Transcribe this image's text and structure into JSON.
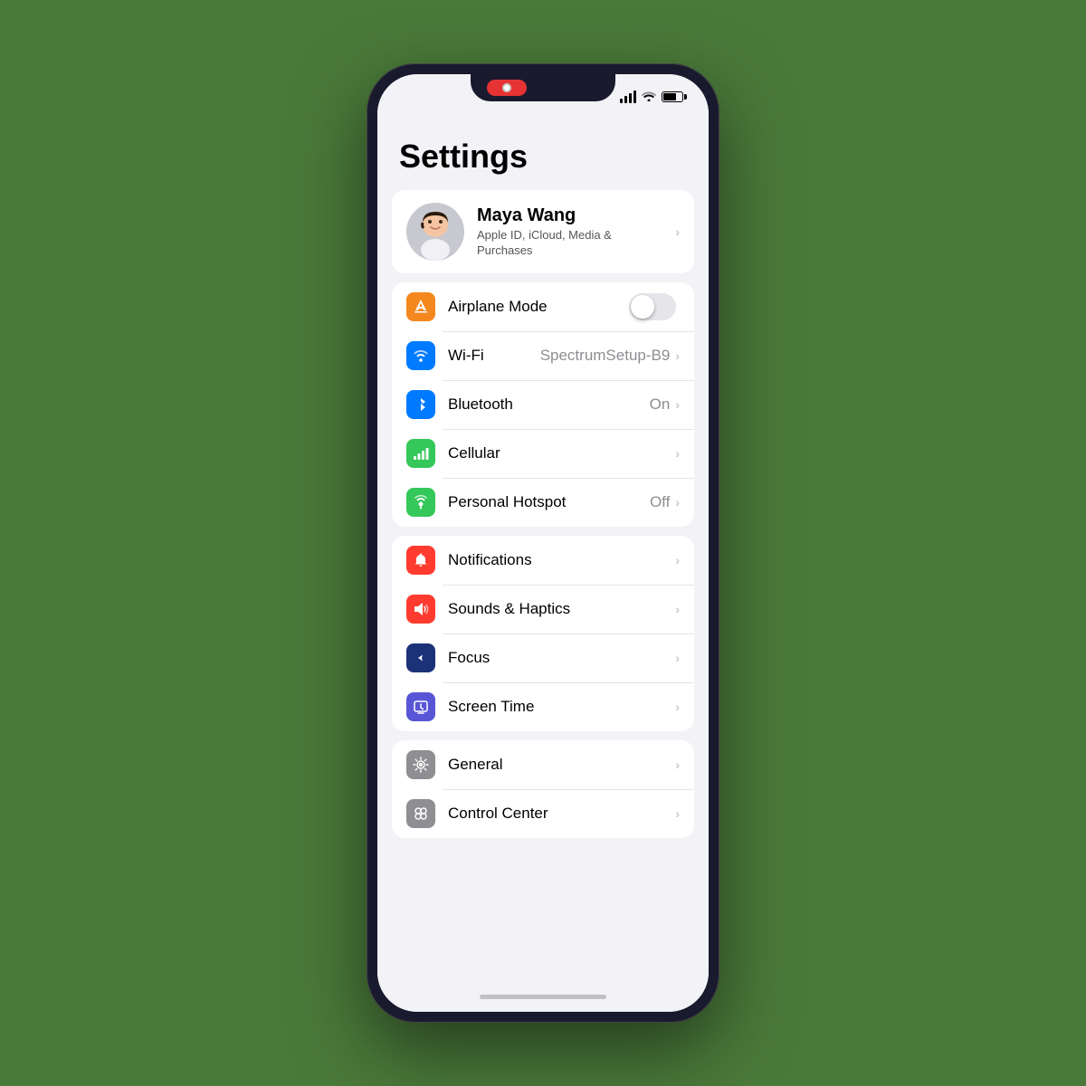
{
  "background_color": "#4a7a3a",
  "phone": {
    "status_bar": {
      "signal_label": "signal",
      "wifi_label": "wifi",
      "battery_label": "battery"
    },
    "screen": {
      "title": "Settings",
      "profile": {
        "name": "Maya Wang",
        "subtitle": "Apple ID, iCloud, Media & Purchases",
        "avatar_emoji": "🧑"
      },
      "sections": [
        {
          "id": "connectivity",
          "items": [
            {
              "id": "airplane-mode",
              "label": "Airplane Mode",
              "icon_color": "orange",
              "icon_type": "airplane",
              "control": "toggle",
              "toggle_on": false
            },
            {
              "id": "wifi",
              "label": "Wi-Fi",
              "icon_color": "blue",
              "icon_type": "wifi",
              "value": "SpectrumSetup-B9",
              "control": "chevron"
            },
            {
              "id": "bluetooth",
              "label": "Bluetooth",
              "icon_color": "blue",
              "icon_type": "bluetooth",
              "value": "On",
              "control": "chevron"
            },
            {
              "id": "cellular",
              "label": "Cellular",
              "icon_color": "green",
              "icon_type": "cellular",
              "value": "",
              "control": "chevron"
            },
            {
              "id": "hotspot",
              "label": "Personal Hotspot",
              "icon_color": "green",
              "icon_type": "hotspot",
              "value": "Off",
              "control": "chevron"
            }
          ]
        },
        {
          "id": "notifications-group",
          "items": [
            {
              "id": "notifications",
              "label": "Notifications",
              "icon_color": "red",
              "icon_type": "notifications",
              "value": "",
              "control": "chevron"
            },
            {
              "id": "sounds",
              "label": "Sounds & Haptics",
              "icon_color": "red",
              "icon_type": "sounds",
              "value": "",
              "control": "chevron"
            },
            {
              "id": "focus",
              "label": "Focus",
              "icon_color": "navy",
              "icon_type": "focus",
              "value": "",
              "control": "chevron"
            },
            {
              "id": "screentime",
              "label": "Screen Time",
              "icon_color": "indigo",
              "icon_type": "screentime",
              "value": "",
              "control": "chevron"
            }
          ]
        },
        {
          "id": "general-group",
          "items": [
            {
              "id": "general",
              "label": "General",
              "icon_color": "gray",
              "icon_type": "general",
              "value": "",
              "control": "chevron"
            },
            {
              "id": "control-center",
              "label": "Control Center",
              "icon_color": "gray",
              "icon_type": "controlcenter",
              "value": "",
              "control": "chevron"
            }
          ]
        }
      ]
    }
  }
}
